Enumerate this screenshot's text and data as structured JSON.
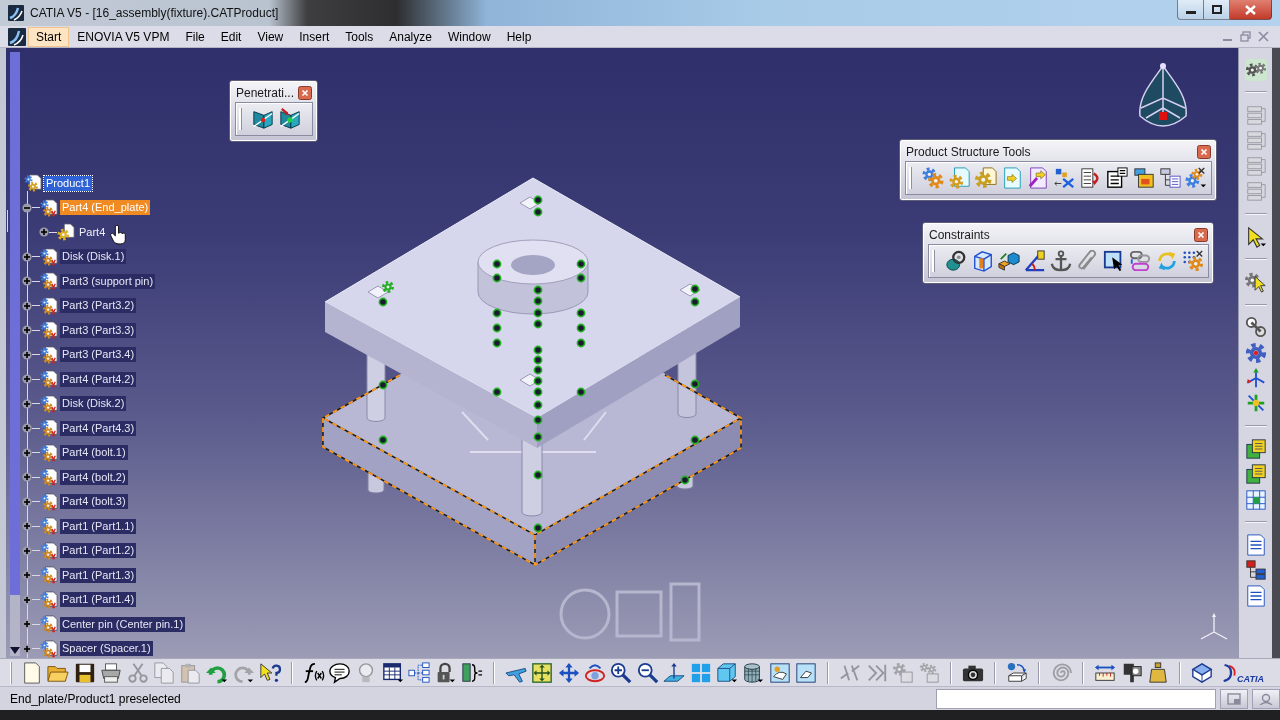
{
  "window": {
    "title": "CATIA V5 - [16_assembly(fixture).CATProduct]"
  },
  "menu": [
    {
      "label": "Start",
      "selected": true
    },
    {
      "label": "ENOVIA V5 VPM",
      "selected": false
    },
    {
      "label": "File",
      "selected": false
    },
    {
      "label": "Edit",
      "selected": false
    },
    {
      "label": "View",
      "selected": false
    },
    {
      "label": "Insert",
      "selected": false
    },
    {
      "label": "Tools",
      "selected": false
    },
    {
      "label": "Analyze",
      "selected": false
    },
    {
      "label": "Window",
      "selected": false
    },
    {
      "label": "Help",
      "selected": false
    }
  ],
  "tree": {
    "items": [
      {
        "label": "Product1",
        "kind": "product",
        "selected": true,
        "preselected": false,
        "children": [
          {
            "label": "Part4 (End_plate)",
            "kind": "component",
            "selected": false,
            "preselected": true,
            "expanded": true,
            "children": [
              {
                "label": "Part4",
                "kind": "part",
                "selected": false,
                "preselected": false,
                "expanded": false
              }
            ]
          },
          {
            "label": "Disk (Disk.1)",
            "kind": "component",
            "selected": false,
            "preselected": false,
            "expanded": false
          },
          {
            "label": "Part3 (support pin)",
            "kind": "component",
            "selected": false,
            "preselected": false,
            "expanded": false
          },
          {
            "label": "Part3 (Part3.2)",
            "kind": "component",
            "selected": false,
            "preselected": false,
            "expanded": false
          },
          {
            "label": "Part3 (Part3.3)",
            "kind": "component",
            "selected": false,
            "preselected": false,
            "expanded": false
          },
          {
            "label": "Part3 (Part3.4)",
            "kind": "component",
            "selected": false,
            "preselected": false,
            "expanded": false
          },
          {
            "label": "Part4 (Part4.2)",
            "kind": "component",
            "selected": false,
            "preselected": false,
            "expanded": false
          },
          {
            "label": "Disk (Disk.2)",
            "kind": "component",
            "selected": false,
            "preselected": false,
            "expanded": false
          },
          {
            "label": "Part4 (Part4.3)",
            "kind": "component",
            "selected": false,
            "preselected": false,
            "expanded": false
          },
          {
            "label": "Part4 (bolt.1)",
            "kind": "component",
            "selected": false,
            "preselected": false,
            "expanded": false
          },
          {
            "label": "Part4 (bolt.2)",
            "kind": "component",
            "selected": false,
            "preselected": false,
            "expanded": false
          },
          {
            "label": "Part4 (bolt.3)",
            "kind": "component",
            "selected": false,
            "preselected": false,
            "expanded": false
          },
          {
            "label": "Part1 (Part1.1)",
            "kind": "component",
            "selected": false,
            "preselected": false,
            "expanded": false
          },
          {
            "label": "Part1 (Part1.2)",
            "kind": "component",
            "selected": false,
            "preselected": false,
            "expanded": false
          },
          {
            "label": "Part1 (Part1.3)",
            "kind": "component",
            "selected": false,
            "preselected": false,
            "expanded": false
          },
          {
            "label": "Part1 (Part1.4)",
            "kind": "component",
            "selected": false,
            "preselected": false,
            "expanded": false
          },
          {
            "label": "Center pin (Center pin.1)",
            "kind": "component",
            "selected": false,
            "preselected": false,
            "expanded": false
          },
          {
            "label": "Spacer (Spacer.1)",
            "kind": "component",
            "selected": false,
            "preselected": false,
            "expanded": false
          }
        ]
      }
    ]
  },
  "floating_toolbars": [
    {
      "title": "Penetrati..."
    },
    {
      "title": "Product Structure Tools"
    },
    {
      "title": "Constraints"
    }
  ],
  "bottom_toolbar": {
    "logo_text": "CATIA"
  },
  "status_bar": {
    "message": "End_plate/Product1 preselected"
  }
}
